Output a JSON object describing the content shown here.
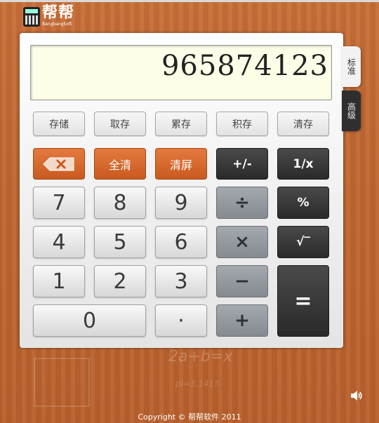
{
  "app": {
    "logo_cn": "帮帮",
    "logo_en": "BangbangSoft"
  },
  "display": {
    "value": "965874123"
  },
  "tabs": {
    "standard": "标准",
    "advanced": "高级"
  },
  "memory_buttons": {
    "ms": "存储",
    "mr": "取存",
    "m_plus": "累存",
    "m_times": "积存",
    "mc": "清存"
  },
  "function_buttons": {
    "clear_all": "全清",
    "clear_screen": "清屏",
    "negate": "+/-",
    "reciprocal": "1/x",
    "percent": "%",
    "sqrt": "√‾"
  },
  "digit_buttons": {
    "d0": "0",
    "d1": "1",
    "d2": "2",
    "d3": "3",
    "d4": "4",
    "d5": "5",
    "d6": "6",
    "d7": "7",
    "d8": "8",
    "d9": "9",
    "dot": "·"
  },
  "operator_buttons": {
    "divide": "÷",
    "multiply": "×",
    "subtract": "−",
    "add": "+",
    "equals": "="
  },
  "footer": {
    "copyright": "Copyright © 帮帮软件 2011"
  },
  "colors": {
    "wood": "#c06834",
    "orange_key": "#d3682d",
    "dark_key": "#333333",
    "gray_key": "#8e9499",
    "display_bg": "#fdfde8"
  },
  "icons": {
    "backspace": "backspace-icon",
    "speaker": "speaker-icon",
    "logo": "calculator-logo-icon"
  }
}
